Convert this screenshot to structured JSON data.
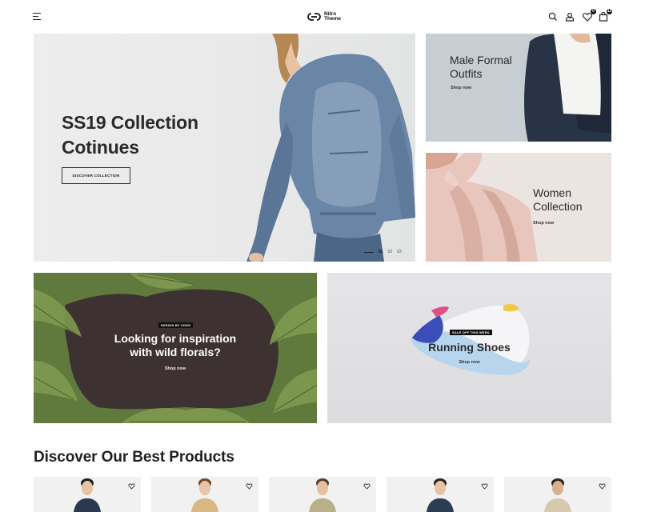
{
  "header": {
    "menu_icon": "hamburger-icon",
    "logo": {
      "line1": "Nitro",
      "line2": "Theme"
    },
    "icons": [
      "search-icon",
      "user-icon",
      "heart-icon",
      "cart-icon"
    ],
    "wishlist_count": "0",
    "cart_count": "12"
  },
  "hero": {
    "title_line1": "SS19 Collection",
    "title_line2": "Cotinues",
    "button": "DISCOVER COLLECTION",
    "slides": [
      "01",
      "02",
      "03"
    ],
    "active_slide": "01"
  },
  "banners": {
    "male": {
      "title_line1": "Male Formal",
      "title_line2": "Outfits",
      "link": "Shop now"
    },
    "women": {
      "title_line1": "Women",
      "title_line2": "Collection",
      "link": "Shop now"
    },
    "florals": {
      "tag": "DESIGN BY CDKE",
      "title_line1": "Looking for inspiration",
      "title_line2": "with wild florals?",
      "link": "Shop now"
    },
    "shoes": {
      "tag": "SALE OFF THIS WEEK",
      "title": "Running Shoes",
      "link": "Shop now"
    }
  },
  "products": {
    "title": "Discover Our Best Products",
    "items": [
      {
        "name": "product-1",
        "shirt": "#2c3850"
      },
      {
        "name": "product-2",
        "shirt": "#d8b884"
      },
      {
        "name": "product-3",
        "shirt": "#b9b08a"
      },
      {
        "name": "product-4",
        "shirt": "#2d3c55"
      },
      {
        "name": "product-5",
        "shirt": "#d7c9b0"
      }
    ]
  }
}
